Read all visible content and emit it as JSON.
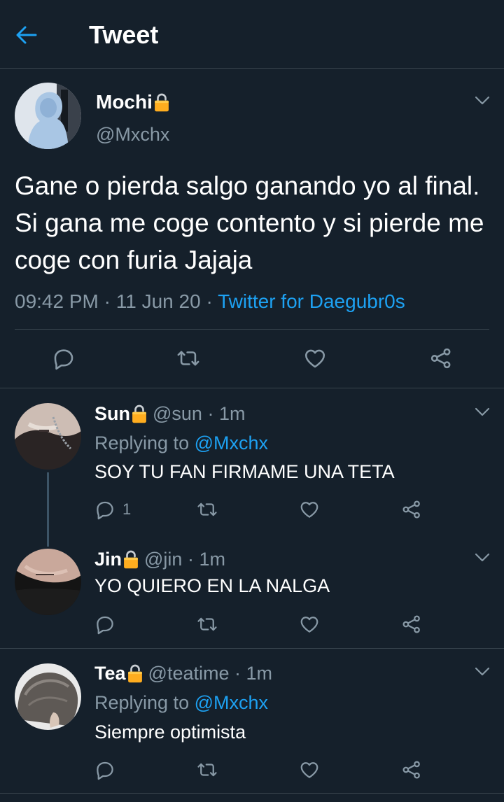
{
  "header": {
    "title": "Tweet",
    "back_icon": "arrow-left-icon"
  },
  "tweet": {
    "name": "Mochi",
    "handle": "@Mxchx",
    "text": "Gane o pierda salgo ganando yo al final. Si gana me coge contento y si pierde me coge con furia Jajaja",
    "time": "09:42 PM",
    "date": "11 Jun 20",
    "source": "Twitter for Daegubr0s",
    "sep": "·"
  },
  "replies": [
    {
      "name": "Sun",
      "handle": "@sun",
      "time": "1m",
      "replying_label": "Replying to",
      "replying_to": "@Mxchx",
      "text": "SOY TU FAN FIRMAME UNA TETA",
      "reply_count": "1"
    },
    {
      "name": "Jin",
      "handle": "@jin",
      "time": "1m",
      "text": "YO QUIERO EN LA NALGA"
    },
    {
      "name": "Tea",
      "handle": "@teatime",
      "time": "1m",
      "replying_label": "Replying to",
      "replying_to": "@Mxchx",
      "text": "Siempre optimista"
    }
  ],
  "colors": {
    "background": "#15202b",
    "accent": "#1da1f2",
    "muted": "#8899a6",
    "lock": "#ffad1f",
    "divider": "#38444d"
  },
  "icons": [
    "arrow-left-icon",
    "lock-icon",
    "chevron-down-icon",
    "reply-icon",
    "retweet-icon",
    "like-icon",
    "share-icon"
  ]
}
